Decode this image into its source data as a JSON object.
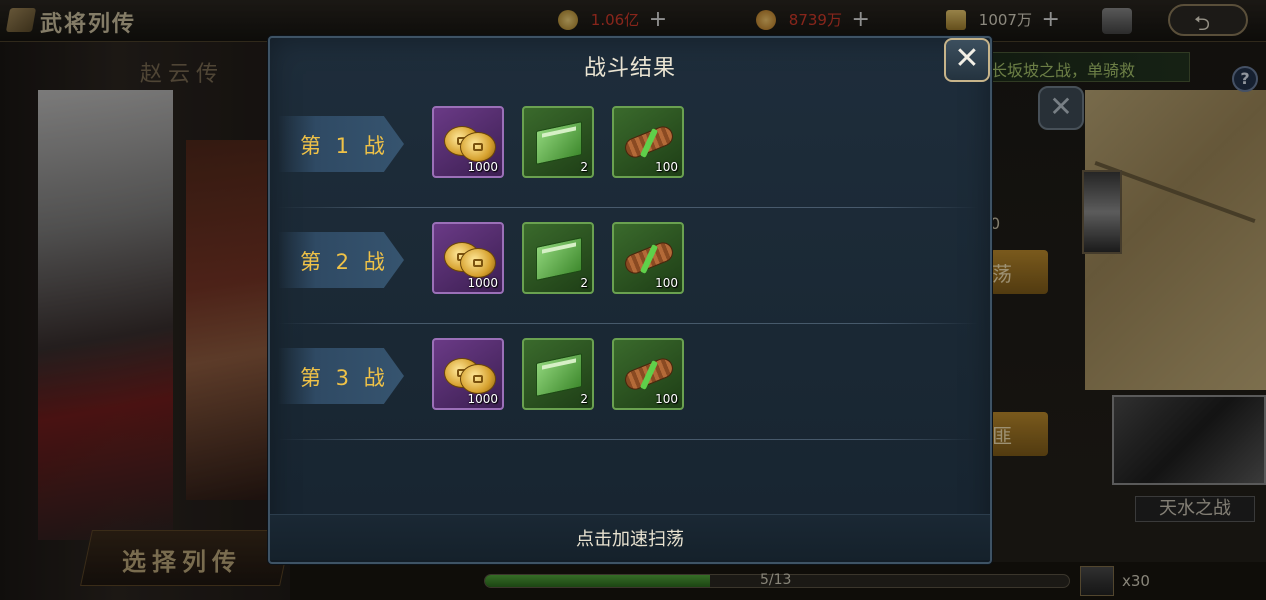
{
  "background": {
    "title": "武将列传",
    "resources": [
      {
        "name": "gold",
        "value": "1.06亿",
        "color": "#d23a2a"
      },
      {
        "name": "silver",
        "value": "8739万",
        "color": "#d23a2a"
      },
      {
        "name": "honor",
        "value": "1007万",
        "color": "#d8d2c2"
      }
    ],
    "hero_name": "赵云传",
    "select_button": "选择列传",
    "subtitle_banner": "长坂坡之战，单骑救",
    "side_number": "0",
    "side_button_1": "荡",
    "side_button_2": "匪",
    "battle_label": "天水之战",
    "progress": {
      "text": "5/13",
      "current": 5,
      "total": 13
    },
    "unit_count": "x30"
  },
  "modal": {
    "title": "战斗结果",
    "close_label": "✕",
    "footer": "点击加速扫荡",
    "battles": [
      {
        "label": "第 1 战",
        "rewards": [
          {
            "type": "copper-coins",
            "count": "1000",
            "frame": "purple"
          },
          {
            "type": "green-book",
            "count": "2",
            "frame": "green"
          },
          {
            "type": "scroll",
            "count": "100",
            "frame": "green"
          }
        ]
      },
      {
        "label": "第 2 战",
        "rewards": [
          {
            "type": "copper-coins",
            "count": "1000",
            "frame": "purple"
          },
          {
            "type": "green-book",
            "count": "2",
            "frame": "green"
          },
          {
            "type": "scroll",
            "count": "100",
            "frame": "green"
          }
        ]
      },
      {
        "label": "第 3 战",
        "rewards": [
          {
            "type": "copper-coins",
            "count": "1000",
            "frame": "purple"
          },
          {
            "type": "green-book",
            "count": "2",
            "frame": "green"
          },
          {
            "type": "scroll",
            "count": "100",
            "frame": "green"
          }
        ]
      }
    ]
  },
  "colors": {
    "battle_tag_text": "#f0c247",
    "modal_bg": "#1e2d3b",
    "purple_frame": "#6a3a86",
    "green_frame": "#3a6a2c"
  }
}
